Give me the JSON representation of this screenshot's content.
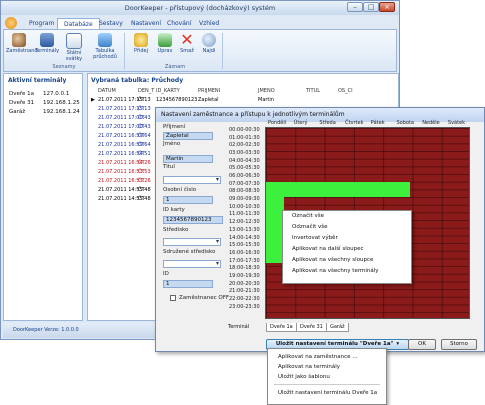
{
  "window": {
    "title": "DoorKeeper - přístupový (docházkový) systém"
  },
  "ribbon_tabs": [
    "Program",
    "Databáze",
    "Sestavy",
    "Nastavení",
    "Chování",
    "Vzhled"
  ],
  "ribbon_groups": {
    "seznamy": {
      "label": "Seznamy",
      "buttons": [
        "Zaměstnanci",
        "Terminály",
        "Státní svátky",
        "Tabulka průchodů"
      ]
    },
    "zaznam": {
      "label": "Záznam",
      "buttons": [
        "Přidej",
        "Uprav",
        "Smaž",
        "Najdi"
      ]
    }
  },
  "left_panel": {
    "title": "Aktivní terminály",
    "rows": [
      {
        "name": "Dveře 1a",
        "ip": "127.0.0.1"
      },
      {
        "name": "Dveře 31",
        "ip": "192.168.1.25"
      },
      {
        "name": "Garáž",
        "ip": "192.168.1.24"
      }
    ]
  },
  "right_panel": {
    "title": "Vybraná tabulka: Průchody",
    "columns": [
      "DATUM",
      "DEN_T",
      "ID_KARTY",
      "PRIJMENI",
      "JMENO",
      "TITUL",
      "OS_CI"
    ],
    "rows": [
      {
        "date": "21.07.2011 17:15:13",
        "day": "ČT",
        "id": "1234567890123",
        "prijmeni": "Zapletal",
        "jmeno": "Martin"
      },
      {
        "date": "21.07.2011 17:15:13",
        "day": "ČT"
      },
      {
        "date": "21.07.2011 17:00:43",
        "day": "ČT"
      },
      {
        "date": "21.07.2011 17:00:43",
        "day": "ČT"
      },
      {
        "date": "21.07.2011 16:59:64",
        "day": "ČT"
      },
      {
        "date": "21.07.2011 16:59:64",
        "day": "ČT"
      },
      {
        "date": "21.07.2011 16:54:51",
        "day": "ČT"
      },
      {
        "date": "21.07.2011 16:54:26",
        "day": "ČT"
      },
      {
        "date": "21.07.2011 16:53:53",
        "day": "ČT"
      },
      {
        "date": "21.07.2011 16:53:26",
        "day": "ČT"
      },
      {
        "date": "21.07.2011 14:55:48",
        "day": "ČT"
      },
      {
        "date": "21.07.2011 14:55:48",
        "day": "ČT"
      }
    ]
  },
  "status_bar": "DoorKeeper  Verze: 1.0.0.0",
  "dialog": {
    "title": "Nastavení zaměstnance a přístupu k jednotlivým terminálům",
    "fields": {
      "prijmeni_label": "Příjmení",
      "prijmeni_value": "Zapletal",
      "jmeno_label": "Jméno",
      "jmeno_value": "Martin",
      "titul_label": "Titul",
      "osobni_cislo_label": "Osobní číslo",
      "osobni_cislo_value": "1",
      "id_karty_label": "ID karty",
      "id_karty_value": "1234567890123",
      "stredisko_label": "Středisko",
      "sdruzene_label": "Sdružené středisko",
      "id_label": "ID",
      "id_value": "1",
      "zamestnanec_off": "Zaměstnanec OFF"
    },
    "days": [
      "Pondělí",
      "Úterý",
      "Středa",
      "Čtvrtek",
      "Pátek",
      "Sobota",
      "Neděle",
      "Svátek"
    ],
    "times": [
      "00:00-00:30",
      "01:00-01:30",
      "02:00-02:30",
      "03:00-03:30",
      "04:00-04:30",
      "05:00-05:30",
      "06:00-06:30",
      "07:00-07:30",
      "08:00-08:30",
      "09:00-09:30",
      "10:00-10:30",
      "11:00-11:30",
      "12:00-12:30",
      "13:00-13:30",
      "14:00-14:30",
      "15:00-15:30",
      "16:00-16:30",
      "17:00-17:30",
      "18:00-18:30",
      "19:00-19:30",
      "20:00-20:30",
      "21:00-21:30",
      "22:00-22:30",
      "23:00-23:30",
      "Terminál"
    ],
    "context_menu": [
      "Označit vše",
      "Odznačit vše",
      "Invertovat výběr",
      "Aplikovat na další sloupec",
      "Aplikovat na všechny sloupce",
      "Aplikovat na všechny terminály"
    ],
    "terminal_tabs": [
      "Dveře 1a",
      "Dveře 31",
      "Garáž"
    ],
    "save_button": "Uložit nastavení terminálu \"Dveře 1a\"",
    "ok_button": "OK",
    "cancel_button": "Storno"
  },
  "popup_menu": [
    "Aplikovat na zaměstnance ...",
    "Aplikovat na terminály",
    "Uložit jako šablonu",
    "Uložit nastavení terminálu  Dveře 1a"
  ]
}
